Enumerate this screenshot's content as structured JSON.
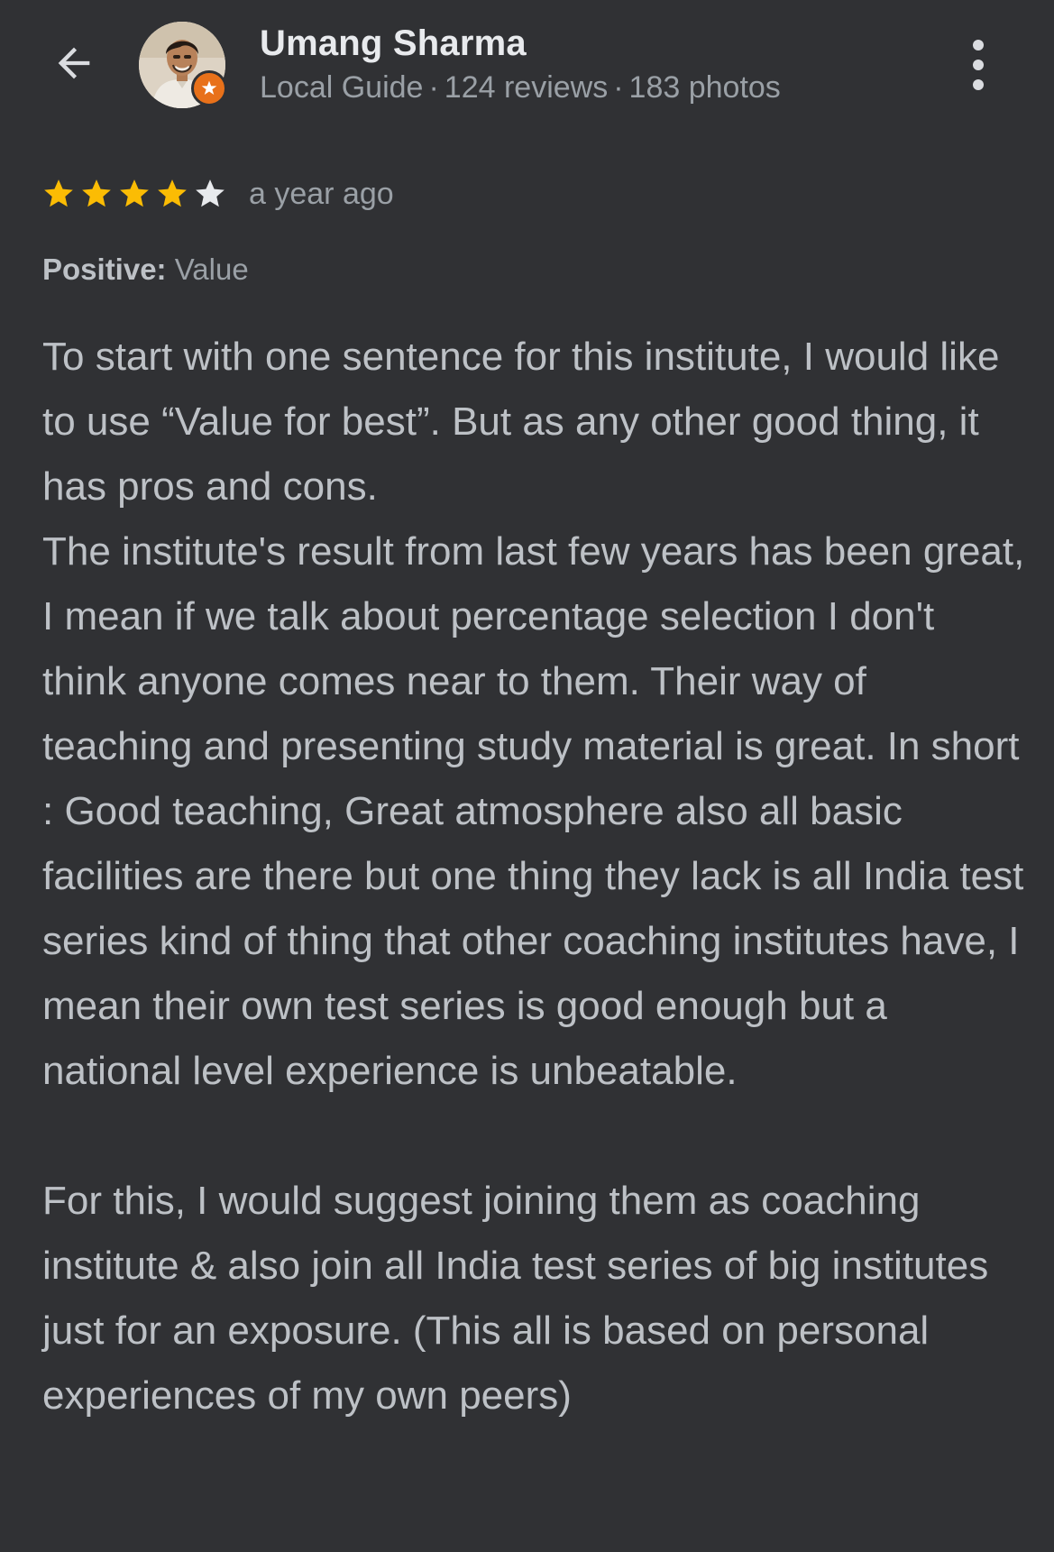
{
  "header": {
    "back_icon": "arrow-back-icon",
    "reviewer": {
      "name": "Umang Sharma",
      "guide_label": "Local Guide",
      "reviews": "124 reviews",
      "photos": "183 photos",
      "separator": "·",
      "badge_icon": "local-guide-star-icon"
    },
    "more_icon": "more-vert-icon"
  },
  "rating": {
    "stars_filled": 4,
    "stars_total": 5,
    "star_color": "#fbbc04",
    "empty_star_color": "#e8eaed",
    "time_ago": "a year ago"
  },
  "attributes": {
    "label": "Positive:",
    "value": "Value"
  },
  "review": {
    "paragraph_1": "To start with one sentence for this institute, I would like to use “Value for best”. But as any other good thing, it has pros and cons.",
    "paragraph_2": "The institute's result from last few years has been great, I mean if we talk about percentage selection I don't think anyone comes near to them. Their way of teaching and presenting study material is great. In short : Good teaching, Great atmosphere also all basic facilities are there but one thing they lack is all India test series kind of thing that other coaching institutes have, I mean their own test series is good enough but a national level experience is unbeatable.",
    "paragraph_3": "For this, I would suggest joining them as coaching institute & also join all India test series of big institutes just for an exposure. (This all is based on personal experiences of my own peers)"
  },
  "colors": {
    "background": "#303134",
    "text_primary": "#e8eaed",
    "text_secondary": "#9aa0a6",
    "text_body": "#bdc1c6",
    "badge": "#e8711a"
  }
}
